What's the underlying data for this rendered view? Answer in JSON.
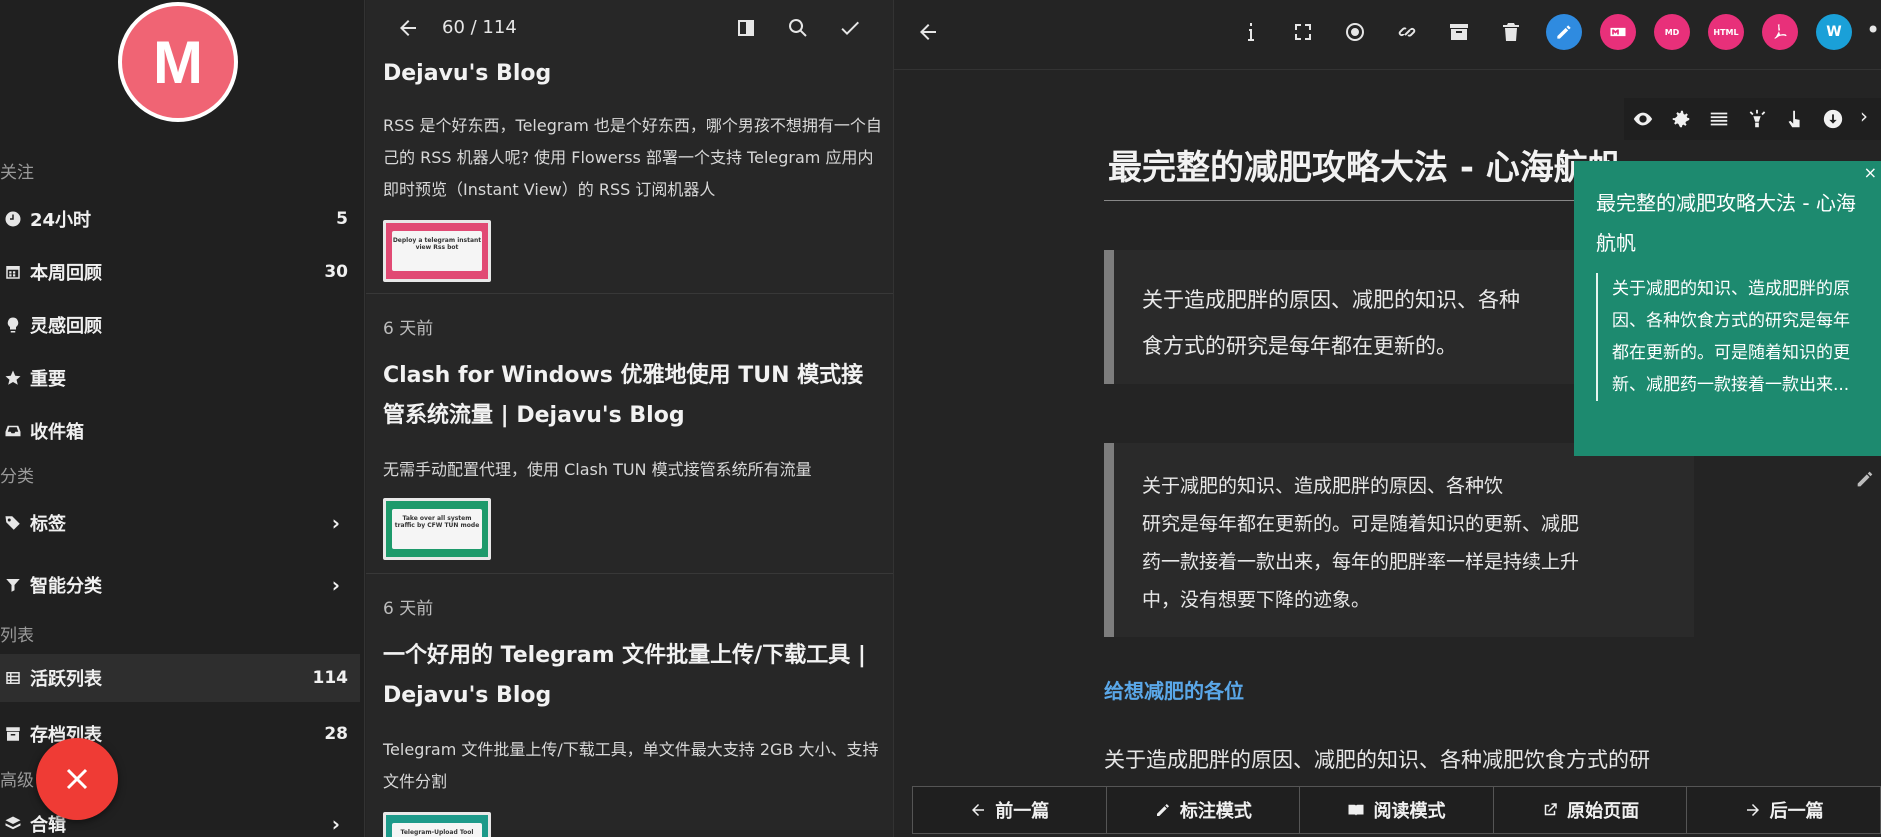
{
  "sidebar": {
    "avatar_letter": "M",
    "sections": {
      "follow": "关注",
      "category": "分类",
      "lists": "列表",
      "advanced": "高级"
    },
    "items": [
      {
        "label": "24小时",
        "count": "5",
        "icon": "clock-icon"
      },
      {
        "label": "本周回顾",
        "count": "30",
        "icon": "calendar-icon"
      },
      {
        "label": "灵感回顾",
        "count": "",
        "icon": "lightbulb-icon"
      },
      {
        "label": "重要",
        "count": "",
        "icon": "star-icon"
      },
      {
        "label": "收件箱",
        "count": "",
        "icon": "inbox-icon"
      },
      {
        "label": "标签",
        "count": "",
        "icon": "tags-icon"
      },
      {
        "label": "智能分类",
        "count": "",
        "icon": "filter-icon"
      },
      {
        "label": "活跃列表",
        "count": "114",
        "icon": "list-icon"
      },
      {
        "label": "存档列表",
        "count": "28",
        "icon": "archive-icon"
      },
      {
        "label": "合辑",
        "count": "",
        "icon": "layers-icon"
      }
    ],
    "colors": {
      "avatar": "#f06474",
      "fab": "#ef3b35"
    }
  },
  "list": {
    "pager": "60 / 114",
    "items": [
      {
        "time": "",
        "title": "Dejavu's Blog",
        "desc": "RSS 是个好东西，Telegram 也是个好东西，哪个男孩不想拥有一个自己的 RSS 机器人呢? 使用 Flowerss 部署一个支持 Telegram 应用内即时预览（Instant View）的 RSS 订阅机器人",
        "thumb": "Deploy a telegram instant view Rss bot",
        "thumb_color": "#e14a74"
      },
      {
        "time": "6 天前",
        "title": "Clash for Windows 优雅地使用 TUN 模式接管系统流量 | Dejavu's Blog",
        "desc": "无需手动配置代理，使用 Clash TUN 模式接管系统所有流量",
        "thumb": "Take over all system traffic by CFW TUN mode",
        "thumb_color": "#1d9a6b"
      },
      {
        "time": "6 天前",
        "title": "一个好用的 Telegram 文件批量上传/下载工具 | Dejavu's Blog",
        "desc": "Telegram 文件批量上传/下载工具，单文件最大支持 2GB 大小、支持文件分割",
        "thumb": "Telegram-Upload Tool",
        "thumb_color": "#1d9a8a"
      }
    ]
  },
  "article": {
    "toolbar_circles": [
      {
        "name": "pen-icon",
        "color": "#2f8be0",
        "text": ""
      },
      {
        "name": "markdown-icon",
        "color": "#e8307a",
        "text": ""
      },
      {
        "name": "md-icon",
        "color": "#e8307a",
        "text": "MD"
      },
      {
        "name": "html-icon",
        "color": "#e8307a",
        "text": "HTML"
      },
      {
        "name": "pdf-icon",
        "color": "#e8307a",
        "text": ""
      },
      {
        "name": "word-icon",
        "color": "#1aa0d8",
        "text": "W"
      }
    ],
    "title": "最完整的减肥攻略大法 - 心海航帆",
    "quote1": "关于造成肥胖的原因、减肥的知识、各种减肥饮食方式的研究是每年都在更新的。",
    "quote1_visible_line1": "关于造成肥胖的原因、减肥的知识、各种",
    "quote1_visible_line2": "食方式的研究是每年都在更新的。",
    "quote2": "关于减肥的知识、造成肥胖的原因、各种饮研究是每年都在更新的。可是随着知识的更新、减肥药一款接着一款出来，每年的肥胖率一样是持续上升中，没有想要下降的迹象。",
    "quote2_lines": [
      "关于减肥的知识、造成肥胖的原因、各种饮",
      "研究是每年都在更新的。可是随着知识的更新、减肥",
      "药一款接着一款出来，每年的肥胖率一样是持续上升",
      "中，没有想要下降的迹象。"
    ],
    "heading": "给想减肥的各位",
    "paragraph": "关于造成肥胖的原因、减肥的知识、各种减肥饮食方式的研",
    "tooltip": {
      "title": "最完整的减肥攻略大法 - 心海航帆",
      "body": "关于减肥的知识、造成肥胖的原因、各种饮食方式的研究是每年都在更新的。可是随着知识的更新、减肥药一款接着一款出来..."
    },
    "bottom": {
      "prev": "前一篇",
      "mark": "标注模式",
      "read": "阅读模式",
      "origin": "原始页面",
      "next": "后一篇"
    }
  }
}
